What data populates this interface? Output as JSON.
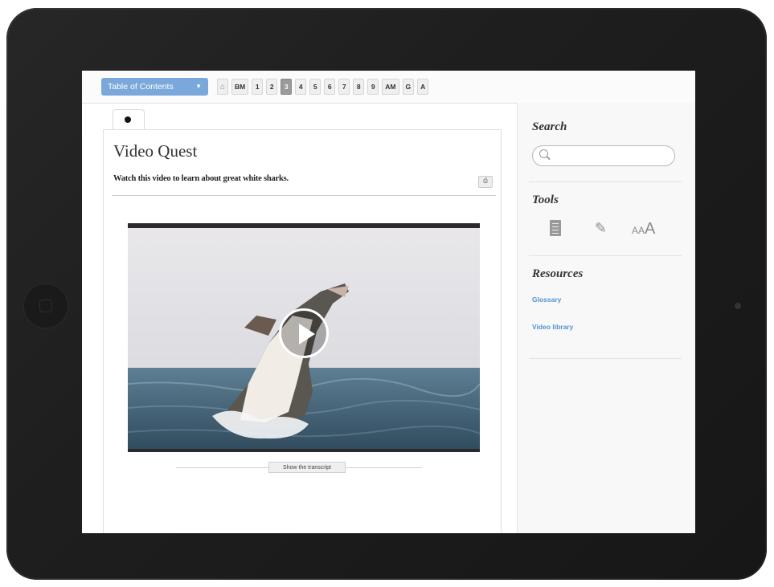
{
  "toolbar": {
    "toc_label": "Table of Contents",
    "pages": [
      "BM",
      "1",
      "2",
      "3",
      "4",
      "5",
      "6",
      "7",
      "8",
      "9",
      "AM",
      "G",
      "A"
    ],
    "active_page": "3"
  },
  "content": {
    "title": "Video Quest",
    "subtitle": "Watch this video to learn about great white sharks.",
    "print_label": "⎙",
    "transcript_label": "Show the transcript"
  },
  "sidebar": {
    "search_heading": "Search",
    "search_placeholder": "",
    "tools_heading": "Tools",
    "tools": [
      "notebook-icon",
      "pencil-icon",
      "text-size-icon"
    ],
    "resources_heading": "Resources",
    "resources": [
      "Glossary",
      "Video library"
    ]
  },
  "colors": {
    "accent": "#7aa8da",
    "link": "#4f94d4",
    "bezel": "#1e1e1e"
  }
}
